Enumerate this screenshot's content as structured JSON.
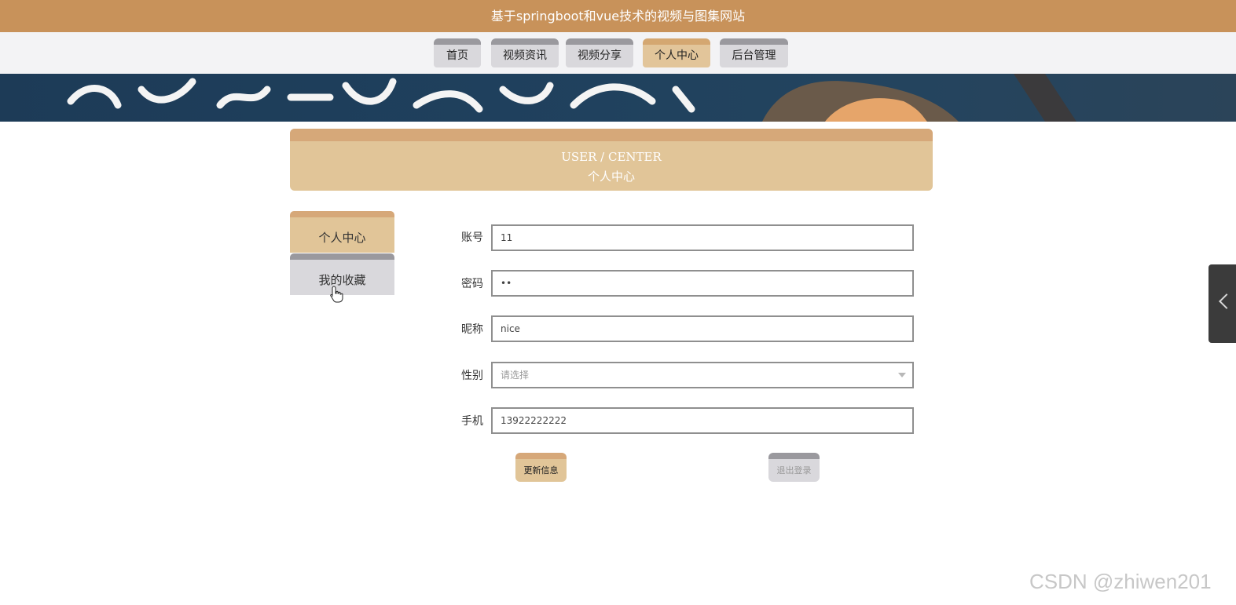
{
  "header": {
    "site_title": "基于springboot和vue技术的视频与图集网站"
  },
  "nav": {
    "items": [
      {
        "label": "首页"
      },
      {
        "label": "视频资讯"
      },
      {
        "label": "视频分享"
      },
      {
        "label": "个人中心"
      },
      {
        "label": "后台管理"
      }
    ],
    "active_index": 3
  },
  "page_header": {
    "title_en": "USER / CENTER",
    "title_cn": "个人中心"
  },
  "sidebar": {
    "items": [
      {
        "label": "个人中心"
      },
      {
        "label": "我的收藏"
      }
    ],
    "active_index": 0
  },
  "form": {
    "account": {
      "label": "账号",
      "value": "11"
    },
    "password": {
      "label": "密码",
      "value": "••"
    },
    "nickname": {
      "label": "昵称",
      "value": "nice"
    },
    "gender": {
      "label": "性别",
      "placeholder": "请选择"
    },
    "phone": {
      "label": "手机",
      "value": "13922222222"
    }
  },
  "buttons": {
    "update_label": "更新信息",
    "logout_label": "退出登录"
  },
  "watermark": {
    "text": "CSDN @zhiwen201"
  },
  "colors": {
    "primary_brown": "#c8925a",
    "tan": "#e1c598",
    "tan_dark": "#d6a879",
    "grey_tab": "#d9d8dc",
    "grey_tab_top": "#9a999e"
  },
  "icons": {
    "side_toggle": "chevron-left-icon",
    "select_caret": "caret-down-icon",
    "cursor": "hand-pointer-icon"
  }
}
